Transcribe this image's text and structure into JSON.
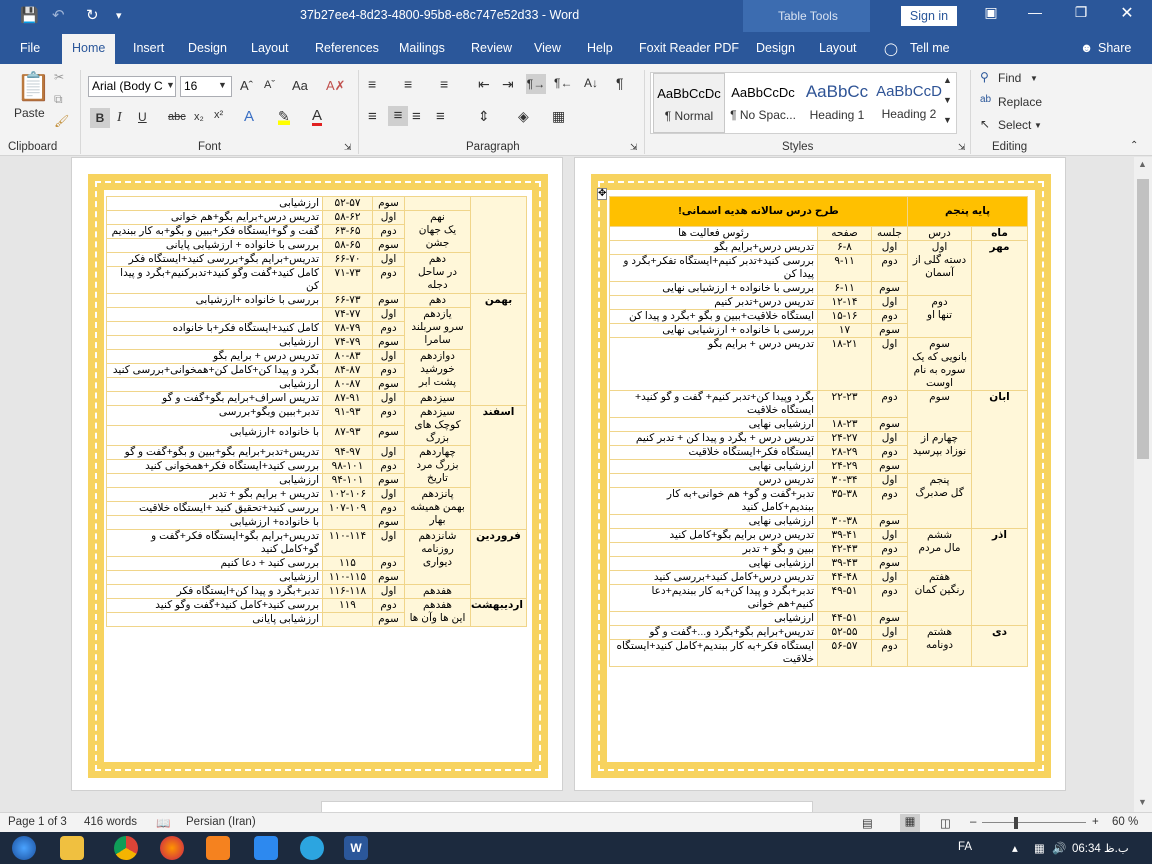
{
  "titlebar": {
    "doc_title": "37b27ee4-8d23-4800-95b8-e8c747e52d33  -  Word",
    "table_tools": "Table Tools",
    "sign_in": "Sign in"
  },
  "tabs": [
    "File",
    "Home",
    "Insert",
    "Design",
    "Layout",
    "References",
    "Mailings",
    "Review",
    "View",
    "Help",
    "Foxit Reader PDF",
    "Design",
    "Layout"
  ],
  "tell_me": "Tell me",
  "share": "Share",
  "ribbon": {
    "paste": "Paste",
    "clipboard": "Clipboard",
    "font_name": "Arial (Body C",
    "font_size": "16",
    "font": "Font",
    "paragraph": "Paragraph",
    "styles_label": "Styles",
    "styles": [
      {
        "sample": "AaBbCcDc",
        "name": "¶ Normal"
      },
      {
        "sample": "AaBbCcDc",
        "name": "¶ No Spac..."
      },
      {
        "sample": "AaBbCc",
        "name": "Heading 1"
      },
      {
        "sample": "AaBbCcD",
        "name": "Heading 2"
      }
    ],
    "find": "Find",
    "replace": "Replace",
    "select": "Select",
    "editing": "Editing"
  },
  "right_page": {
    "header": {
      "grade": "پایه پنجم",
      "title": "طرح درس سالانه هدیه اسمانی!"
    },
    "columns": [
      "ماه",
      "درس",
      "جلسه",
      "صفحه",
      "رئوس فعالیت ها"
    ],
    "rows": [
      {
        "month": "مهر",
        "lesson": "اول\nدسته گلی از آسمان",
        "session": "اول",
        "page": "۶-۸",
        "act": "تدریس درس+برایم بگو"
      },
      {
        "month": "",
        "lesson": "",
        "session": "دوم",
        "page": "۹-۱۱",
        "act": "بررسی کنید+تدبر کنیم+ایستگاه تفکر+بگرد و پیدا کن"
      },
      {
        "month": "",
        "lesson": "",
        "session": "سوم",
        "page": "۶-۱۱",
        "act": "بررسی با خانواده + ارزشیابی نهایی"
      },
      {
        "month": "",
        "lesson": "دوم\nتنها او",
        "session": "اول",
        "page": "۱۲-۱۴",
        "act": "تدریس درس+تدبر کنیم"
      },
      {
        "month": "",
        "lesson": "",
        "session": "دوم",
        "page": "۱۵-۱۶",
        "act": "ایستگاه خلاقیت+ببین و بگو +بگرد و پیدا کن"
      },
      {
        "month": "",
        "lesson": "",
        "session": "سوم",
        "page": "۱۷",
        "act": "بررسی با خانواده + ارزشیابی نهایی"
      },
      {
        "month": "",
        "lesson": "سوم\nبانویی که یک سوره به نام اوست",
        "session": "اول",
        "page": "۱۸-۲۱",
        "act": "تدریس درس + برایم بگو"
      },
      {
        "month": "ابان",
        "lesson": "سوم",
        "session": "دوم",
        "page": "۲۲-۲۳",
        "act": "بگرد وپیدا کن+تدبر کنیم+ گفت و گو کنید+ ایستگاه خلاقیت"
      },
      {
        "month": "",
        "lesson": "",
        "session": "سوم",
        "page": "۱۸-۲۳",
        "act": "ارزشیابی نهایی"
      },
      {
        "month": "",
        "lesson": "چهارم از نوزاد بپرسید",
        "session": "اول",
        "page": "۲۴-۲۷",
        "act": "تدریس درس + بگرد و پیدا کن + تدبر کنیم"
      },
      {
        "month": "",
        "lesson": "",
        "session": "دوم",
        "page": "۲۸-۲۹",
        "act": "ایستگاه فکر+ایستگاه خلاقیت"
      },
      {
        "month": "",
        "lesson": "",
        "session": "سوم",
        "page": "۲۴-۲۹",
        "act": "ارزشیابی نهایی"
      },
      {
        "month": "",
        "lesson": "پنجم\nگل صدبرگ",
        "session": "اول",
        "page": "۳۰-۳۴",
        "act": "تدریس درس"
      },
      {
        "month": "",
        "lesson": "",
        "session": "دوم",
        "page": "۳۵-۳۸",
        "act": "تدبر+گفت و گو+ هم خوانی+به کار ببندیم+کامل کنید"
      },
      {
        "month": "",
        "lesson": "",
        "session": "سوم",
        "page": "۳۰-۳۸",
        "act": "ارزشیابی نهایی"
      },
      {
        "month": "اذر",
        "lesson": "ششم\nمال مردم",
        "session": "اول",
        "page": "۳۹-۴۱",
        "act": "تدریس درس برایم بگو+کامل کنید"
      },
      {
        "month": "",
        "lesson": "",
        "session": "دوم",
        "page": "۴۲-۴۳",
        "act": "ببین و بگو + تدبر"
      },
      {
        "month": "",
        "lesson": "",
        "session": "سوم",
        "page": "۳۹-۴۳",
        "act": "ارزشیابی نهایی"
      },
      {
        "month": "",
        "lesson": "هفتم\nرنگین کمان",
        "session": "اول",
        "page": "۴۴-۴۸",
        "act": "تدریس درس+کامل کنید+بررسی کنید"
      },
      {
        "month": "",
        "lesson": "",
        "session": "دوم",
        "page": "۴۹-۵۱",
        "act": "تدبر+بگرد و پیدا کن+به کار ببندیم+دعا کنیم+هم خوانی"
      },
      {
        "month": "",
        "lesson": "",
        "session": "سوم",
        "page": "۴۴-۵۱",
        "act": "ارزشیابی"
      },
      {
        "month": "دی",
        "lesson": "هشتم\nدونامه",
        "session": "اول",
        "page": "۵۲-۵۵",
        "act": "تدریس+برایم بگو+بگرد و...+گفت و گو"
      },
      {
        "month": "",
        "lesson": "",
        "session": "دوم",
        "page": "۵۶-۵۷",
        "act": "ایستگاه فکر+به کار ببندیم+کامل کنید+ایستگاه خلاقیت"
      }
    ]
  },
  "left_page": {
    "rows": [
      {
        "month": "",
        "lesson": "",
        "session": "سوم",
        "page": "۵۲-۵۷",
        "act": "ارزشیابی"
      },
      {
        "month": "",
        "lesson": "نهم\nیک جهان جشن",
        "session": "اول",
        "page": "۵۸-۶۲",
        "act": "تدریس درس+برایم بگو+هم خوانی"
      },
      {
        "month": "",
        "lesson": "",
        "session": "دوم",
        "page": "۶۳-۶۵",
        "act": "گفت و گو+ایستگاه فکر+ببین و بگو+به کار ببندیم"
      },
      {
        "month": "",
        "lesson": "",
        "session": "سوم",
        "page": "۵۸-۶۵",
        "act": "بررسی با خانواده + ارزشیابی پایانی"
      },
      {
        "month": "",
        "lesson": "دهم\nدر ساحل دجله",
        "session": "اول",
        "page": "۶۶-۷۰",
        "act": "تدریس+برایم بگو+بررسی کنید+ایستگاه فکر"
      },
      {
        "month": "",
        "lesson": "",
        "session": "دوم",
        "page": "۷۱-۷۳",
        "act": "کامل کنید+گفت وگو کنید+تدبرکنیم+بگرد و پیدا کن"
      },
      {
        "month": "بهمن",
        "lesson": "دهم",
        "session": "سوم",
        "page": "۶۶-۷۳",
        "act": "بررسی با خانواده +ارزشیابی"
      },
      {
        "month": "",
        "lesson": "یازدهم\nسرو سربلند سامرا",
        "session": "اول",
        "page": "۷۴-۷۷",
        "act": ""
      },
      {
        "month": "",
        "lesson": "",
        "session": "دوم",
        "page": "۷۸-۷۹",
        "act": "کامل کنید+ایستگاه فکر+با خانواده"
      },
      {
        "month": "",
        "lesson": "",
        "session": "سوم",
        "page": "۷۴-۷۹",
        "act": "ارزشیابی"
      },
      {
        "month": "",
        "lesson": "دوازدهم\nخورشید پشت ابر",
        "session": "اول",
        "page": "۸۰-۸۳",
        "act": "تدریس درس + برایم بگو"
      },
      {
        "month": "",
        "lesson": "",
        "session": "دوم",
        "page": "۸۴-۸۷",
        "act": "بگرد و پیدا کن+کامل کن+همخوانی+بررسی کنید"
      },
      {
        "month": "",
        "lesson": "",
        "session": "سوم",
        "page": "۸۰-۸۷",
        "act": "ارزشیابی"
      },
      {
        "month": "",
        "lesson": "سیزدهم",
        "session": "اول",
        "page": "۸۷-۹۱",
        "act": "تدریس اسراف+برایم بگو+گفت و گو"
      },
      {
        "month": "اسفند",
        "lesson": "سیزدهم\nکوچک های بزرگ",
        "session": "دوم",
        "page": "۹۱-۹۳",
        "act": "تدبر+ببین وبگو+بررسی"
      },
      {
        "month": "",
        "lesson": "",
        "session": "سوم",
        "page": "۸۷-۹۳",
        "act": "با خانواده +ارزشیابی"
      },
      {
        "month": "",
        "lesson": "چهاردهم\nبزرگ مرد تاریخ",
        "session": "اول",
        "page": "۹۴-۹۷",
        "act": "تدریس+تدبر+برایم بگو+ببین و بگو+گفت و گو"
      },
      {
        "month": "",
        "lesson": "",
        "session": "دوم",
        "page": "۹۸-۱۰۱",
        "act": "بررسی کنید+ایستگاه فکر+همخوانی کنید"
      },
      {
        "month": "",
        "lesson": "",
        "session": "سوم",
        "page": "۹۴-۱۰۱",
        "act": "ارزشیابی"
      },
      {
        "month": "",
        "lesson": "پانزدهم\nبهمن همیشه بهار",
        "session": "اول",
        "page": "۱۰۲-۱۰۶",
        "act": "تدریس + برایم بگو + تدبر"
      },
      {
        "month": "",
        "lesson": "",
        "session": "دوم",
        "page": "۱۰۷-۱۰۹",
        "act": "بررسی کنید+تحقیق کنید +ایستگاه خلاقیت"
      },
      {
        "month": "",
        "lesson": "",
        "session": "سوم",
        "page": "",
        "act": "با خانواده+ ارزشیابی"
      },
      {
        "month": "فروردین",
        "lesson": "شانزدهم\nروزنامه دیواری",
        "session": "اول",
        "page": "۱۱۰-۱۱۴",
        "act": "تدریس+برایم بگو+ایستگاه فکر+گفت و گو+کامل کنید"
      },
      {
        "month": "",
        "lesson": "",
        "session": "دوم",
        "page": "۱۱۵",
        "act": "بررسی کنید + دعا کنیم"
      },
      {
        "month": "",
        "lesson": "",
        "session": "سوم",
        "page": "۱۱۰-۱۱۵",
        "act": "ارزشیابی"
      },
      {
        "month": "",
        "lesson": "هفدهم",
        "session": "اول",
        "page": "۱۱۶-۱۱۸",
        "act": "تدبر+بگرد و پیدا کن+ایستگاه فکر"
      },
      {
        "month": "اردیبهشت",
        "lesson": "هفدهم\nاین ها وآن ها",
        "session": "دوم",
        "page": "۱۱۹",
        "act": "بررسی کنید+کامل کنید+گفت وگو کنید"
      },
      {
        "month": "",
        "lesson": "",
        "session": "سوم",
        "page": "",
        "act": "ارزشیابی پایانی"
      }
    ]
  },
  "status": {
    "page": "Page 1 of 3",
    "words": "416 words",
    "lang": "Persian (Iran)",
    "zoom": "60 %"
  },
  "tray": {
    "lang": "FA",
    "time": "06:34 ب.ظ"
  }
}
